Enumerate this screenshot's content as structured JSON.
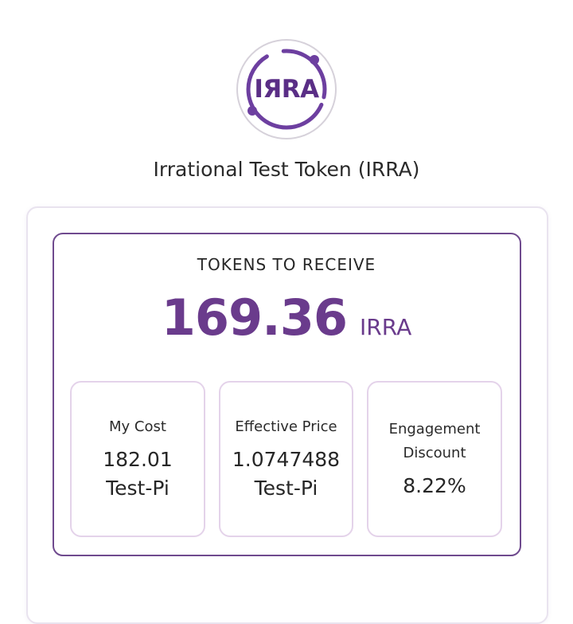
{
  "token": {
    "logo_text": "IЯRA",
    "title": "Irrational Test Token (IRRA)"
  },
  "receive": {
    "label": "TOKENS TO RECEIVE",
    "amount": "169.36",
    "unit": "IRRA"
  },
  "stats": [
    {
      "label": "My Cost",
      "value": "182.01 Test-Pi"
    },
    {
      "label": "Effective Price",
      "value": "1.0747488 Test-Pi"
    },
    {
      "label": "Engagement Discount",
      "value": "8.22%"
    }
  ],
  "colors": {
    "brand_purple": "#6a3b8c",
    "card_border": "#6f4a8e",
    "stat_border": "#e4d3ea"
  }
}
